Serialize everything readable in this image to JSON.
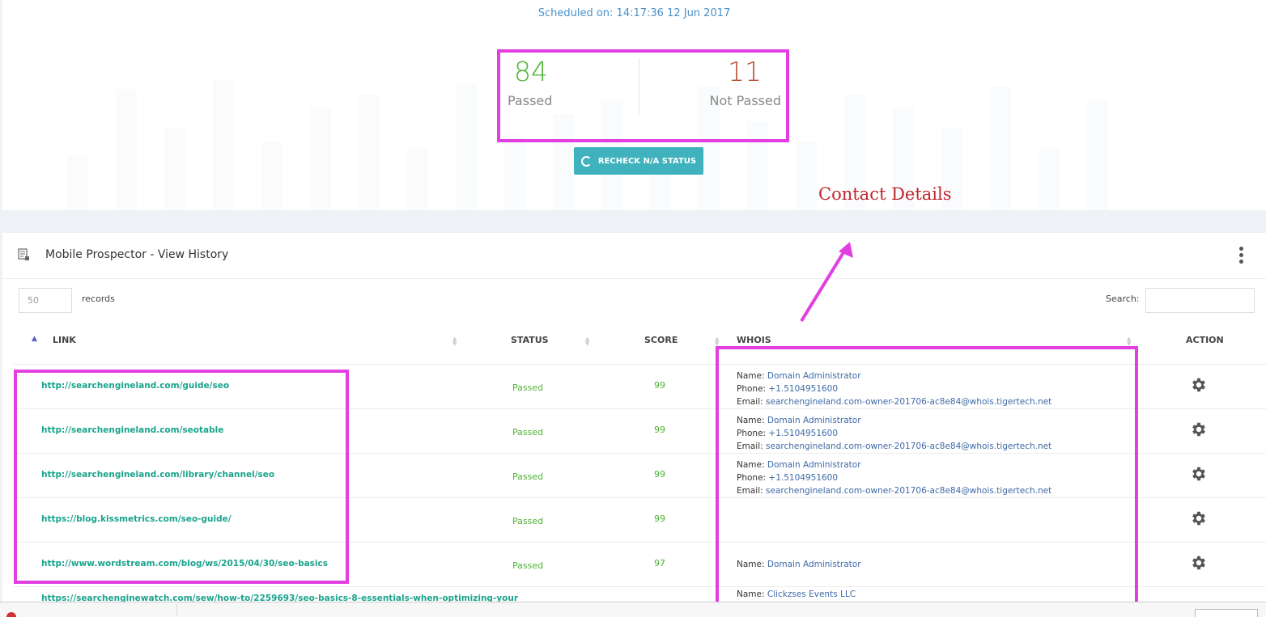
{
  "summary": {
    "scheduled": "Scheduled on: 14:17:36 12 Jun 2017",
    "passed_count": "84",
    "passed_label": "Passed",
    "not_passed_count": "11",
    "not_passed_label": "Not Passed",
    "recheck_label": "RECHECK N/A STATUS"
  },
  "annotation": {
    "label": "Contact Details",
    "color": "#c0262f",
    "highlight_color": "#e23fe2"
  },
  "panel": {
    "title": "Mobile Prospector - View History",
    "records_value": "50",
    "records_label": "records",
    "search_label": "Search:"
  },
  "table": {
    "columns": [
      "LINK",
      "STATUS",
      "SCORE",
      "WHOIS",
      "ACTION"
    ],
    "rows": [
      {
        "link": "http://searchengineland.com/guide/seo",
        "status": "Passed",
        "score": "99",
        "whois": [
          {
            "k": "Name:",
            "v": "Domain Administrator"
          },
          {
            "k": "Phone:",
            "v": "+1.5104951600"
          },
          {
            "k": "Email:",
            "v": "searchengineland.com-owner-201706-ac8e84@whois.tigertech.net"
          }
        ]
      },
      {
        "link": "http://searchengineland.com/seotable",
        "status": "Passed",
        "score": "99",
        "whois": [
          {
            "k": "Name:",
            "v": "Domain Administrator"
          },
          {
            "k": "Phone:",
            "v": "+1.5104951600"
          },
          {
            "k": "Email:",
            "v": "searchengineland.com-owner-201706-ac8e84@whois.tigertech.net"
          }
        ]
      },
      {
        "link": "http://searchengineland.com/library/channel/seo",
        "status": "Passed",
        "score": "99",
        "whois": [
          {
            "k": "Name:",
            "v": "Domain Administrator"
          },
          {
            "k": "Phone:",
            "v": "+1.5104951600"
          },
          {
            "k": "Email:",
            "v": "searchengineland.com-owner-201706-ac8e84@whois.tigertech.net"
          }
        ]
      },
      {
        "link": "https://blog.kissmetrics.com/seo-guide/",
        "status": "Passed",
        "score": "99",
        "whois": []
      },
      {
        "link": "http://www.wordstream.com/blog/ws/2015/04/30/seo-basics",
        "status": "Passed",
        "score": "97",
        "whois": [
          {
            "k": "Name:",
            "v": "Domain Administrator"
          }
        ]
      },
      {
        "link": "https://searchenginewatch.com/sew/how-to/2259693/seo-basics-8-essentials-when-optimizing-your",
        "status": "",
        "score": "",
        "whois": [
          {
            "k": "Name:",
            "v": "Clickzses Events LLC"
          }
        ]
      }
    ]
  }
}
